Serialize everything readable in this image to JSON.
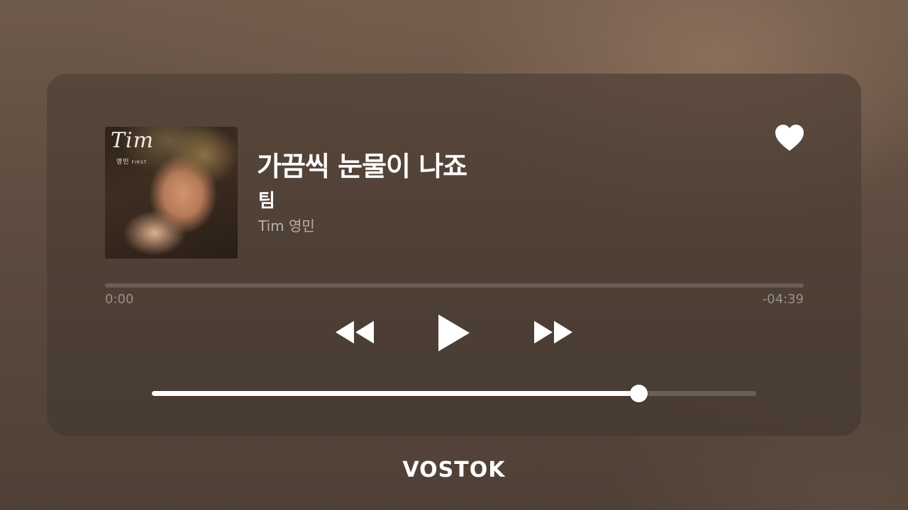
{
  "track": {
    "title": "가끔씩 눈물이 나죠",
    "artist": "팀",
    "album": "Tim 영민"
  },
  "cover": {
    "name_text": "Tim",
    "sub_text": "영민",
    "edition_text": "FIRST"
  },
  "favorite": {
    "icon": "heart-icon",
    "liked": true
  },
  "playback": {
    "elapsed": "0:00",
    "remaining": "-04:39",
    "progress": 0.0,
    "controls": [
      "rewind-icon",
      "play-icon",
      "fast-forward-icon"
    ]
  },
  "volume": {
    "level": 0.805
  },
  "brand": {
    "name": "VOSTOK"
  },
  "colors": {
    "accent": "#ffffff",
    "card": "#4f4036",
    "muted_text": "#a89b91"
  }
}
